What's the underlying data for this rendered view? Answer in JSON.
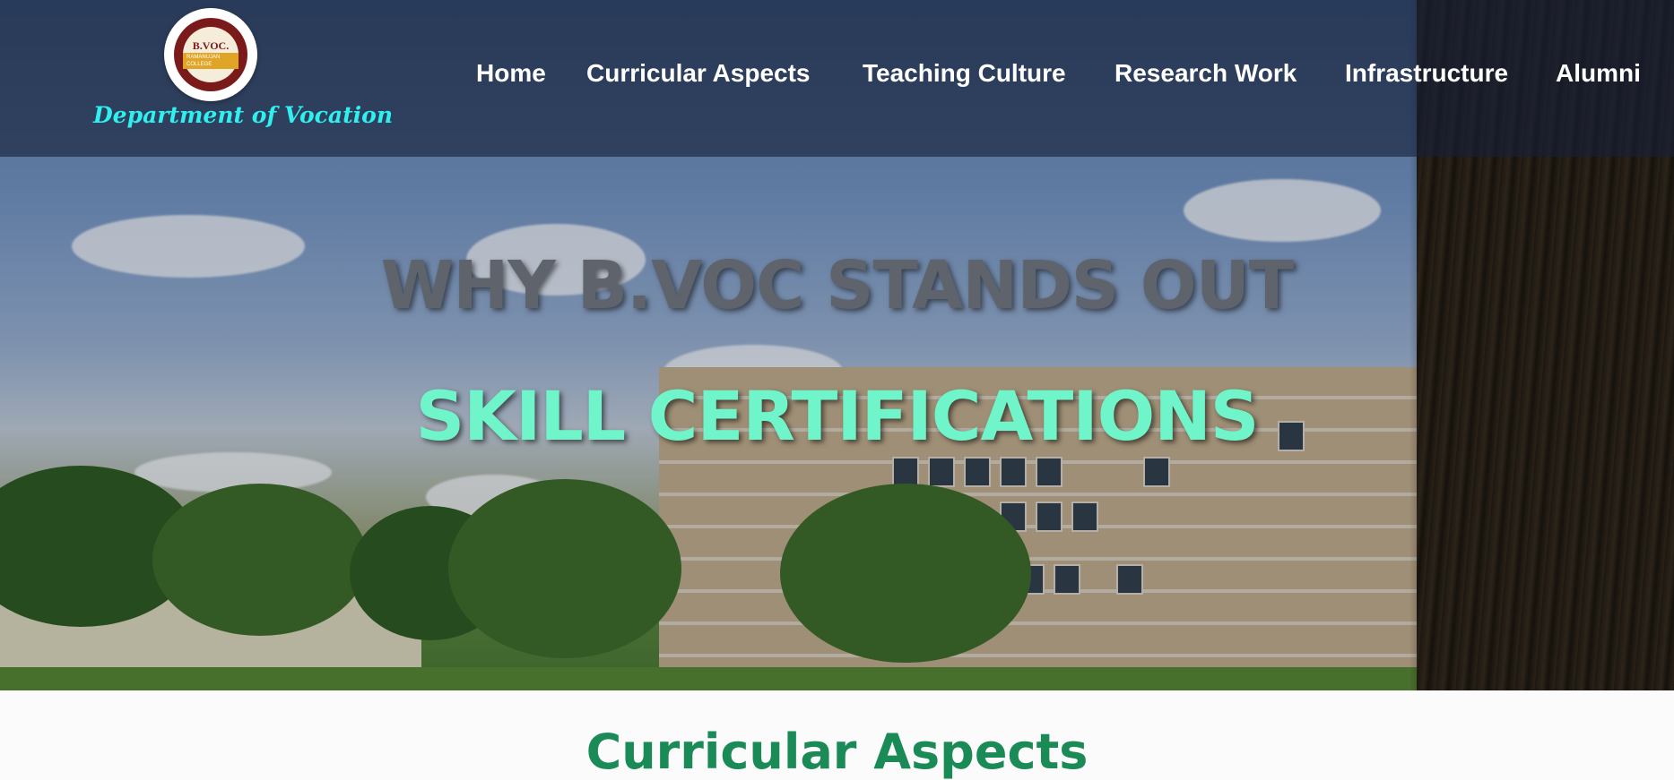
{
  "header": {
    "department_name": "Department of Vocation",
    "logo": {
      "top_text": "B.VOC.",
      "ribbon_text": "RAMANUJAN COLLEGE"
    }
  },
  "nav": {
    "items": [
      {
        "label": "Home"
      },
      {
        "label": "Curricular Aspects"
      },
      {
        "label": "Teaching Culture"
      },
      {
        "label": "Research Work"
      },
      {
        "label": "Infrastructure"
      },
      {
        "label": "Alumni"
      }
    ]
  },
  "hero": {
    "heading": "WHY B.VOC STANDS OUT",
    "subheading": "SKILL CERTIFICATIONS"
  },
  "section": {
    "title": "Curricular Aspects"
  },
  "colors": {
    "nav_text": "#ffffff",
    "department_name": "#2ff0ef",
    "hero_heading": "#5e636c",
    "hero_subheading": "#6ff5c9",
    "section_title": "#1a8a57",
    "logo_maroon": "#7a1a1a",
    "logo_ribbon": "#e0a526"
  }
}
